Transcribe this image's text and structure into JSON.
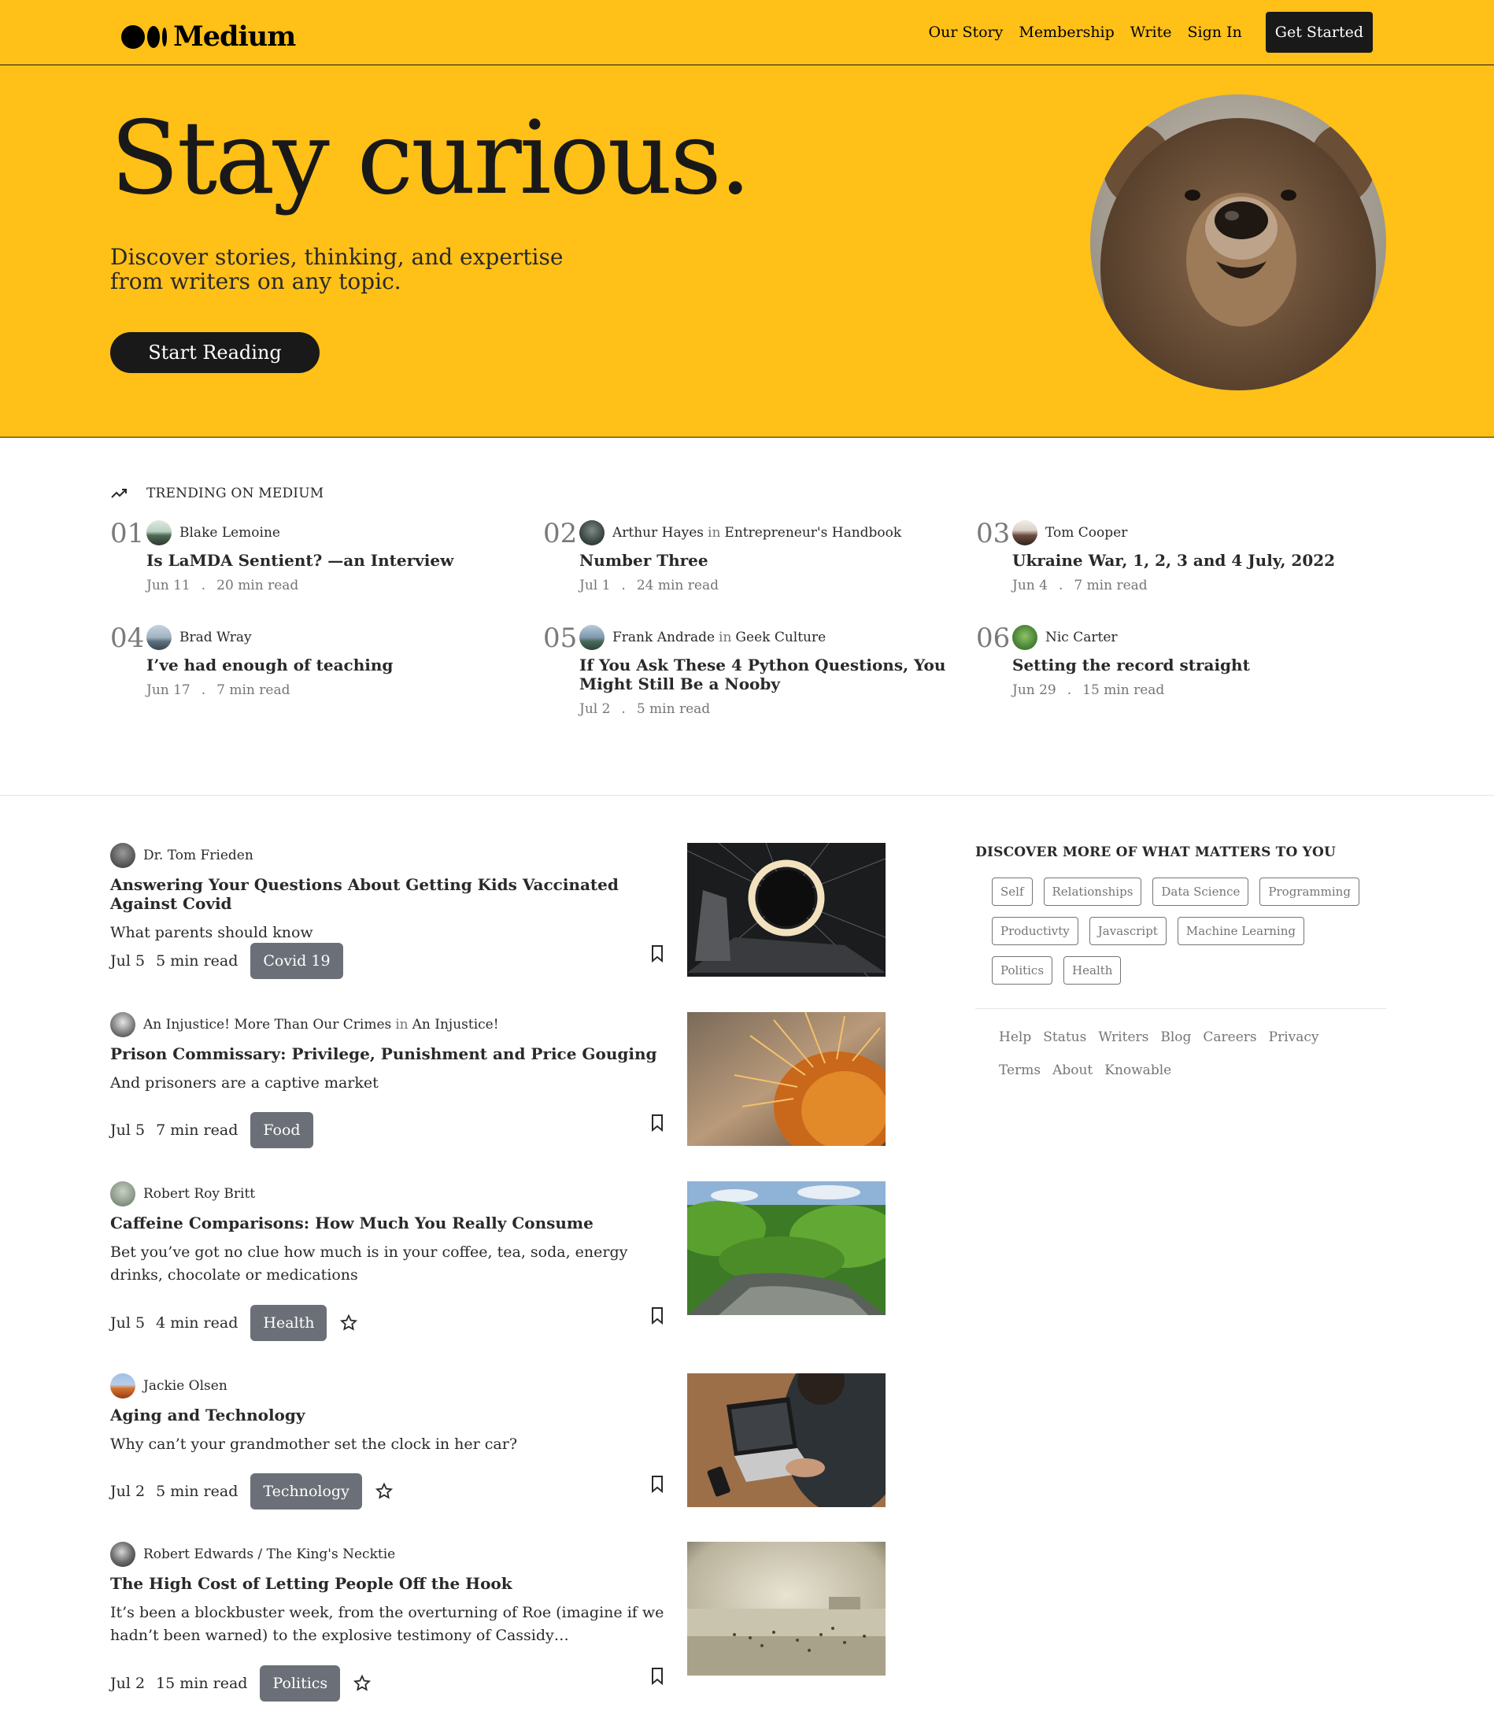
{
  "brand": {
    "name": "Medium"
  },
  "nav": {
    "links": [
      "Our Story",
      "Membership",
      "Write",
      "Sign In"
    ],
    "cta": "Get Started"
  },
  "hero": {
    "title": "Stay curious.",
    "subtitle": "Discover stories, thinking, and expertise from writers on any topic.",
    "button": "Start Reading"
  },
  "trending": {
    "label": "TRENDING ON MEDIUM",
    "items": [
      {
        "num": "01",
        "author": "Blake Lemoine",
        "in": "",
        "publication": "",
        "title": "Is LaMDA Sentient? —an Interview",
        "date": "Jun 11",
        "read": "20 min read"
      },
      {
        "num": "02",
        "author": "Arthur Hayes",
        "in": "in",
        "publication": "Entrepreneur's Handbook",
        "title": "Number Three",
        "date": "Jul 1",
        "read": "24 min read"
      },
      {
        "num": "03",
        "author": "Tom Cooper",
        "in": "",
        "publication": "",
        "title": "Ukraine War, 1, 2, 3 and 4 July, 2022",
        "date": "Jun 4",
        "read": "7 min read"
      },
      {
        "num": "04",
        "author": "Brad Wray",
        "in": "",
        "publication": "",
        "title": "I’ve had enough of teaching",
        "date": "Jun 17",
        "read": "7 min read"
      },
      {
        "num": "05",
        "author": "Frank Andrade",
        "in": "in",
        "publication": "Geek Culture",
        "title": "If You Ask These 4 Python Questions, You Might Still Be a Nooby",
        "date": "Jul 2",
        "read": "5 min read"
      },
      {
        "num": "06",
        "author": "Nic Carter",
        "in": "",
        "publication": "",
        "title": "Setting the record straight",
        "date": "Jun 29",
        "read": "15 min read"
      }
    ],
    "dot": "."
  },
  "feed": [
    {
      "author": "Dr. Tom Frieden",
      "in": "",
      "publication": "",
      "title": "Answering Your Questions About Getting Kids Vaccinated Against Covid",
      "subtitle": "What parents should know",
      "date": "Jul 5",
      "read": "5 min read",
      "tag": "Covid 19",
      "starred": false
    },
    {
      "author": "An Injustice! More Than Our Crimes",
      "in": "in",
      "publication": "An Injustice!",
      "title": "Prison Commissary: Privilege, Punishment and Price Gouging",
      "subtitle": "And prisoners are a captive market",
      "date": "Jul 5",
      "read": "7 min read",
      "tag": "Food",
      "starred": false
    },
    {
      "author": "Robert Roy Britt",
      "in": "",
      "publication": "",
      "title": "Caffeine Comparisons: How Much You Really Consume",
      "subtitle": "Bet you’ve got no clue how much is in your coffee, tea, soda, energy drinks, chocolate or medications",
      "date": "Jul 5",
      "read": "4 min read",
      "tag": "Health",
      "starred": true
    },
    {
      "author": "Jackie Olsen",
      "in": "",
      "publication": "",
      "title": "Aging and Technology",
      "subtitle": "Why can’t your grandmother set the clock in her car?",
      "date": "Jul 2",
      "read": "5 min read",
      "tag": "Technology",
      "starred": true
    },
    {
      "author": "Robert Edwards / The King's Necktie",
      "in": "",
      "publication": "",
      "title": "The High Cost of Letting People Off the Hook",
      "subtitle": "It’s been a blockbuster week, from the overturning of Roe (imagine if we hadn’t been warned) to the explosive testimony of Cassidy…",
      "date": "Jul 2",
      "read": "15 min read",
      "tag": "Politics",
      "starred": true
    }
  ],
  "sidebar": {
    "heading": "DISCOVER MORE OF WHAT MATTERS TO YOU",
    "topics": [
      "Self",
      "Relationships",
      "Data Science",
      "Programming",
      "Productivty",
      "Javascript",
      "Machine Learning",
      "Politics",
      "Health"
    ],
    "footer": [
      "Help",
      "Status",
      "Writers",
      "Blog",
      "Careers",
      "Privacy",
      "Terms",
      "About",
      "Knowable"
    ]
  },
  "colors": {
    "accent": "#FFC017",
    "dark": "#191919",
    "tag_bg": "#6b6f77",
    "muted": "#757575"
  },
  "icons": {
    "trending": "trending-up-icon",
    "bookmark": "bookmark-icon",
    "star": "star-icon"
  }
}
